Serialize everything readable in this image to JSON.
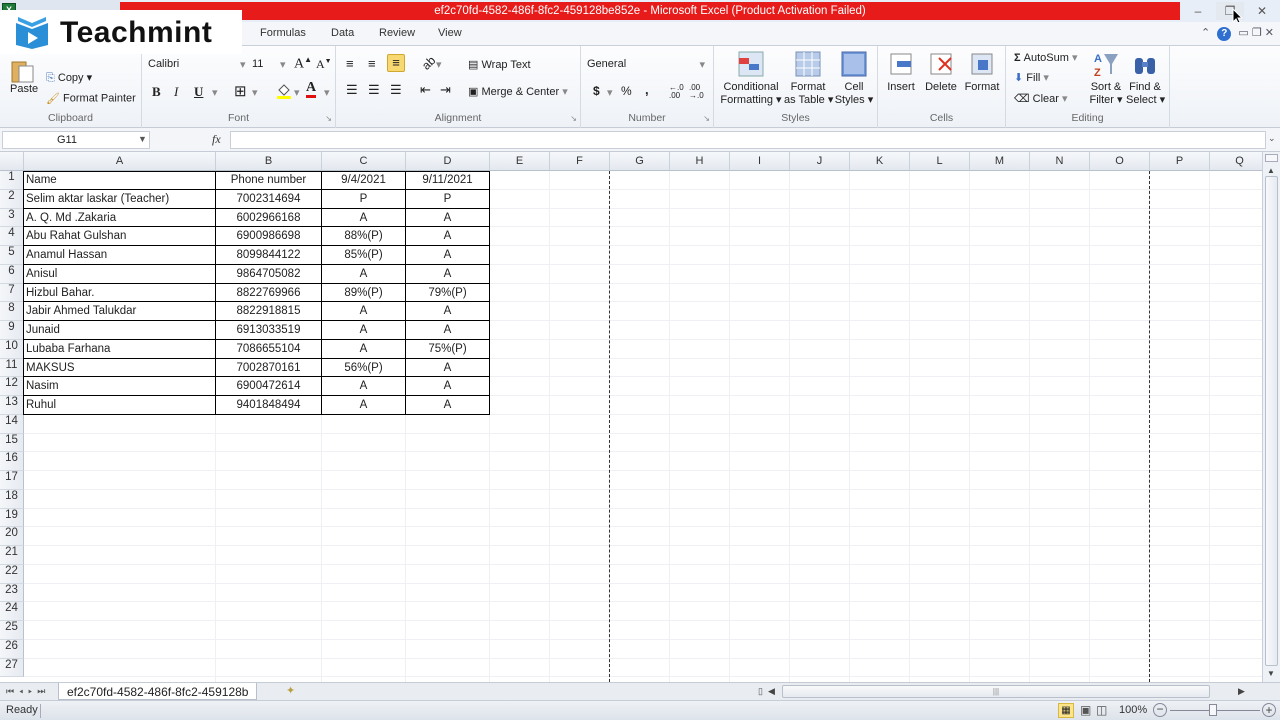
{
  "window": {
    "title": "ef2c70fd-4582-486f-8fc2-459128be852e  -  Microsoft Excel (Product Activation Failed)",
    "accent_color": "#e81b1b",
    "minimize": "–",
    "restore": "❐",
    "close": "✕"
  },
  "watermark": {
    "text": "Teachmint"
  },
  "ribbon_tabs": [
    "Formulas",
    "Data",
    "Review",
    "View"
  ],
  "ribbon": {
    "clipboard": {
      "label": "Clipboard",
      "paste": "Paste",
      "copy": "Copy",
      "format_painter": "Format Painter"
    },
    "font": {
      "label": "Font",
      "font_name": "Calibri",
      "font_size": "11",
      "bold": "B",
      "italic": "I",
      "underline": "U"
    },
    "alignment": {
      "label": "Alignment",
      "wrap_text": "Wrap Text",
      "merge_center": "Merge & Center"
    },
    "number": {
      "label": "Number",
      "format": "General",
      "currency": "$",
      "percent": "%",
      "comma": ","
    },
    "styles": {
      "label": "Styles",
      "conditional_1": "Conditional",
      "conditional_2": "Formatting",
      "format_table_1": "Format",
      "format_table_2": "as Table",
      "cell_styles_1": "Cell",
      "cell_styles_2": "Styles"
    },
    "cells": {
      "label": "Cells",
      "insert": "Insert",
      "delete": "Delete",
      "format": "Format"
    },
    "editing": {
      "label": "Editing",
      "autosum": "AutoSum",
      "fill": "Fill",
      "clear": "Clear",
      "sort_1": "Sort &",
      "sort_2": "Filter",
      "find_1": "Find &",
      "find_2": "Select"
    }
  },
  "formula_bar": {
    "name_box": "G11",
    "fx": "fx",
    "value": ""
  },
  "columns": [
    "A",
    "B",
    "C",
    "D",
    "E",
    "F",
    "G",
    "H",
    "I",
    "J",
    "K",
    "L",
    "M",
    "N",
    "O",
    "P",
    "Q"
  ],
  "rows": [
    "1",
    "2",
    "3",
    "4",
    "5",
    "6",
    "7",
    "8",
    "9",
    "10",
    "11",
    "12",
    "13",
    "14",
    "15",
    "16",
    "17",
    "18",
    "19",
    "20",
    "21",
    "22",
    "23",
    "24",
    "25",
    "26",
    "27"
  ],
  "table": {
    "headers": [
      "Name",
      "Phone number",
      "9/4/2021",
      "9/11/2021"
    ],
    "rows": [
      [
        "Selim aktar laskar (Teacher)",
        "7002314694",
        "P",
        "P"
      ],
      [
        "A. Q. Md .Zakaria",
        "6002966168",
        "A",
        "A"
      ],
      [
        "Abu Rahat Gulshan",
        "6900986698",
        "88%(P)",
        "A"
      ],
      [
        "Anamul Hassan",
        "8099844122",
        "85%(P)",
        "A"
      ],
      [
        "Anisul",
        "9864705082",
        "A",
        "A"
      ],
      [
        "Hizbul Bahar.",
        "8822769966",
        "89%(P)",
        "79%(P)"
      ],
      [
        "Jabir Ahmed Talukdar",
        "8822918815",
        "A",
        "A"
      ],
      [
        "Junaid",
        "6913033519",
        "A",
        "A"
      ],
      [
        "Lubaba Farhana",
        "7086655104",
        "A",
        "75%(P)"
      ],
      [
        "MAKSUS",
        "7002870161",
        "56%(P)",
        "A"
      ],
      [
        "Nasim",
        "6900472614",
        "A",
        "A"
      ],
      [
        "Ruhul",
        "9401848494",
        "A",
        "A"
      ]
    ]
  },
  "sheet_tab": {
    "name": "ef2c70fd-4582-486f-8fc2-459128b"
  },
  "status": {
    "text": "Ready",
    "zoom": "100%"
  }
}
